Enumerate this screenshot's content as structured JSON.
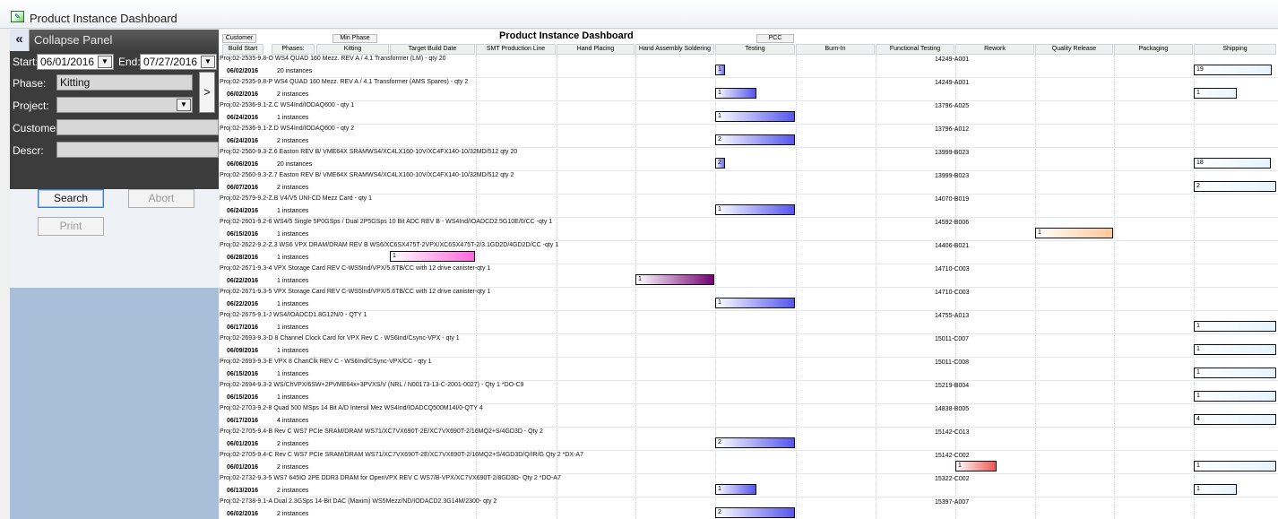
{
  "window": {
    "title": "Product Instance Dashboard"
  },
  "panel": {
    "collapse_label": "Collapse Panel",
    "start_label": "Start:",
    "start_value": "06/01/2016",
    "end_label": "End:",
    "end_value": "07/27/2016",
    "phase_label": "Phase:",
    "phase_value": "Kitting",
    "project_label": "Project:",
    "project_value": "",
    "customer_label": "Customer:",
    "customer_value": "",
    "descr_label": "Descr:",
    "descr_value": "",
    "go_label": ">",
    "search_label": "Search",
    "abort_label": "Abort",
    "print_label": "Print"
  },
  "grid": {
    "title": "Product Instance Dashboard",
    "top_buttons": {
      "customer": "Customer",
      "min_phase": "Min Phase",
      "pcc": "PCC"
    },
    "columns": [
      "Build Start",
      "Phases:",
      "Kitting",
      "Target Build Date",
      "SMT Production Line",
      "Hand Placing",
      "Hand Assembly Soldering",
      "Testing",
      "Burn-In",
      "Functional Testing",
      "Rework",
      "Quality Release",
      "Packaging",
      "Shipping"
    ],
    "rows": [
      {
        "desc": "Proj:02-2535-9.8-O WS4 QUAD 160 Mezz. REV A / 4.1 Transformer (LM) - qty 20",
        "date": "06/02/2016",
        "instances": "20 instances",
        "serial": "14249-A001",
        "bars": [
          {
            "phase": "Testing",
            "label": "1",
            "start": 0.0,
            "len": 0.12,
            "c1": "#ffffff",
            "c2": "#6666ee"
          },
          {
            "phase": "Shipping",
            "label": "19",
            "start": 0.0,
            "len": 0.95,
            "c1": "#ffffff",
            "c2": "#e6f4ff"
          }
        ]
      },
      {
        "desc": "Proj:02-2535-9.8-P WS4 QUAD 160 Mezz. REV A / 4.1 Transformer (AMS Spares) - qty 2",
        "date": "06/02/2016",
        "instances": "2 instances",
        "serial": "14249-A001",
        "bars": [
          {
            "phase": "Testing",
            "label": "1",
            "start": 0.0,
            "len": 0.52,
            "c1": "#ffffff",
            "c2": "#5555ee"
          },
          {
            "phase": "Shipping",
            "label": "1",
            "start": 0.0,
            "len": 0.52,
            "c1": "#ffffff",
            "c2": "#e6f4ff"
          }
        ]
      },
      {
        "desc": "Proj:02-2536-9.1-Z.C WS4Ind/IODAQ600 - qty 1",
        "date": "06/24/2016",
        "instances": "1 instances",
        "serial": "13796-A025",
        "bars": [
          {
            "phase": "Testing",
            "label": "1",
            "start": 0.0,
            "len": 1.0,
            "c1": "#ffffff",
            "c2": "#5555ee"
          }
        ]
      },
      {
        "desc": "Proj:02-2536-9.1-Z.D WS4Ind/IODAQ600 - qty 2",
        "date": "06/24/2016",
        "instances": "2 instances",
        "serial": "13796-A012",
        "bars": [
          {
            "phase": "Testing",
            "label": "2",
            "start": 0.0,
            "len": 1.0,
            "c1": "#ffffff",
            "c2": "#5555ee"
          }
        ]
      },
      {
        "desc": "Proj:02-2560-9.3-Z.6 Easton  REV B/ VME64X SRAMWS4/XC4LX160-10V/XC4FX140-10/32MD/512 qty 20",
        "date": "06/06/2016",
        "instances": "20 instances",
        "serial": "13999-B023",
        "bars": [
          {
            "phase": "Testing",
            "label": "2",
            "start": 0.0,
            "len": 0.12,
            "c1": "#ffffff",
            "c2": "#6666ee"
          },
          {
            "phase": "Shipping",
            "label": "18",
            "start": 0.0,
            "len": 0.93,
            "c1": "#ffffff",
            "c2": "#e6f4ff"
          }
        ]
      },
      {
        "desc": "Proj:02-2560-9.3-Z.7 Easton  REV B/ VME64X SRAMWS4/XC4LX160-10V/XC4FX140-10/32MD/512 qty 2",
        "date": "06/07/2016",
        "instances": "2 instances",
        "serial": "13999-B023",
        "bars": [
          {
            "phase": "Shipping",
            "label": "2",
            "start": 0.0,
            "len": 1.0,
            "c1": "#ffffff",
            "c2": "#e6f4ff"
          }
        ]
      },
      {
        "desc": "Proj:02-2579-9.2-Z.B V4/V5 UNI-CD Mezz Card - qty 1",
        "date": "06/24/2016",
        "instances": "1 instances",
        "serial": "14070-B019",
        "bars": [
          {
            "phase": "Testing",
            "label": "1",
            "start": 0.0,
            "len": 1.0,
            "c1": "#ffffff",
            "c2": "#5555ee"
          }
        ]
      },
      {
        "desc": "Proj:02-2601-9.2-6 WS4/5 Single 5P0GSps / Dual 2P5GSps 10 Bit ADC REV B - WS4Ind/IOADCD2.5G10E/0/CC -qty 1",
        "date": "06/15/2016",
        "instances": "1 instances",
        "serial": "14592-B006",
        "bars": [
          {
            "phase": "Quality Release",
            "label": "1",
            "start": 0.0,
            "len": 1.0,
            "c1": "#ffffff",
            "c2": "#ffc89a"
          }
        ]
      },
      {
        "desc": "Proj:02-2622-9.2-Z.3 WS6 VPX DRAM/DRAM REV B WS6/XC6SX475T-2VPX/XC6SX475T-2/3.1GD2D/4GD2D/CC -qty 1",
        "date": "06/28/2016",
        "instances": "1 instances",
        "serial": "14406-B021",
        "bars": [
          {
            "phase": "Target Build Date",
            "label": "1",
            "start": 0.0,
            "len": 1.0,
            "c1": "#ffffff",
            "c2": "#ff66dd"
          }
        ]
      },
      {
        "desc": "Proj:02-2671-9.3-4 VPX Storage Card REV C-WS5Ind/VPX/5.6TB/CC with 12 drive canister-qty 1",
        "date": "06/22/2016",
        "instances": "1 instances",
        "serial": "14710-C003",
        "bars": [
          {
            "phase": "Hand Assembly Soldering",
            "label": "1",
            "start": 0.0,
            "len": 1.0,
            "c1": "#ffffff",
            "c2": "#770077"
          }
        ]
      },
      {
        "desc": "Proj:02-2671-9.3-5 VPX Storage Card REV C-WS5Ind/VPX/5.6TB/CC with 12 drive canister-qty 1",
        "date": "06/22/2016",
        "instances": "1 instances",
        "serial": "14710-C003",
        "bars": [
          {
            "phase": "Testing",
            "label": "1",
            "start": 0.0,
            "len": 1.0,
            "c1": "#ffffff",
            "c2": "#5555ee"
          }
        ]
      },
      {
        "desc": "Proj:02-2675-9.1-J WS4/IOADCD1.8G12N/0 - QTY 1",
        "date": "06/17/2016",
        "instances": "1 instances",
        "serial": "14755-A013",
        "bars": [
          {
            "phase": "Shipping",
            "label": "1",
            "start": 0.0,
            "len": 1.0,
            "c1": "#ffffff",
            "c2": "#e6f4ff"
          }
        ]
      },
      {
        "desc": "Proj:02-2693-9.3-D 8 Channel Clock Card for VPX Rev C - WS6Ind/Csync-VPX - qty 1",
        "date": "06/09/2016",
        "instances": "1 instances",
        "serial": "15011-C007",
        "bars": [
          {
            "phase": "Shipping",
            "label": "1",
            "start": 0.0,
            "len": 1.0,
            "c1": "#ffffff",
            "c2": "#e6f4ff"
          }
        ]
      },
      {
        "desc": "Proj:02-2693-9.3-E VPX 8 ChanClk REV C - WS6Ind/CSync-VPX/CC - qty 1",
        "date": "06/15/2016",
        "instances": "1 instances",
        "serial": "15011-C008",
        "bars": [
          {
            "phase": "Shipping",
            "label": "1",
            "start": 0.0,
            "len": 1.0,
            "c1": "#ffffff",
            "c2": "#e6f4ff"
          }
        ]
      },
      {
        "desc": "Proj:02-2694-9.3-2 WS/ChVPX/6SW+2PVME64x+3PVXS/V (NRL / N00173-13-C-2001-0027) - Qty 1 *DO-C9",
        "date": "06/15/2016",
        "instances": "1 instances",
        "serial": "15219-B004",
        "bars": [
          {
            "phase": "Shipping",
            "label": "1",
            "start": 0.0,
            "len": 1.0,
            "c1": "#ffffff",
            "c2": "#e6f4ff"
          }
        ]
      },
      {
        "desc": "Proj:02-2703-9.2-8 Quad 500 MSps 14 Bit A/D Intersil Mez WS4Ind/IOADCQ500M14I/0-QTY 4",
        "date": "06/17/2016",
        "instances": "4 instances",
        "serial": "14838-B005",
        "bars": [
          {
            "phase": "Shipping",
            "label": "4",
            "start": 0.0,
            "len": 1.0,
            "c1": "#ffffff",
            "c2": "#e6f4ff"
          }
        ]
      },
      {
        "desc": "Proj:02-2705-9.4-B Rev C WS7 PCIe SRAM/DRAM WS71/XC7VX690T-2E/XC7VX690T-2/16MQ2+S/4GD3D -  Qty 2",
        "date": "06/01/2016",
        "instances": "2 instances",
        "serial": "15142-C013",
        "bars": [
          {
            "phase": "Testing",
            "label": "2",
            "start": 0.0,
            "len": 1.0,
            "c1": "#ffffff",
            "c2": "#5555ee"
          }
        ]
      },
      {
        "desc": "Proj:02-2705-9.4-C Rev C WS7 PCIe SRAM/DRAM WS71/XC7VX690T-2E/XC7VX690T-2/16MQ2+S/4GD3D/Q/IR/G Qty 2 *DX-A7",
        "date": "06/01/2016",
        "instances": "2 instances",
        "serial": "15142-C002",
        "bars": [
          {
            "phase": "Rework",
            "label": "1",
            "start": 0.0,
            "len": 0.52,
            "c1": "#ffffff",
            "c2": "#ee5555"
          },
          {
            "phase": "Shipping",
            "label": "1",
            "start": 0.0,
            "len": 1.0,
            "c1": "#ffffff",
            "c2": "#e6f4ff"
          }
        ]
      },
      {
        "desc": "Proj:02-2732-9.3-5 WS7 645IO 2PE DDR3 DRAM for OpenVPX REV C WS7/B-VPX/XC7VX690T-2/8GD3D- Qty 2 *DO-A7",
        "date": "06/13/2016",
        "instances": "2 instances",
        "serial": "15322-C002",
        "bars": [
          {
            "phase": "Testing",
            "label": "1",
            "start": 0.0,
            "len": 0.52,
            "c1": "#ffffff",
            "c2": "#5555ee"
          },
          {
            "phase": "Shipping",
            "label": "1",
            "start": 0.0,
            "len": 0.52,
            "c1": "#ffffff",
            "c2": "#e6f4ff"
          }
        ]
      },
      {
        "desc": "Proj:02-2738-9.1-A Dual 2.3GSps 14-Bit DAC (Maxim) WS5Mezz/ND/IODACD2.3G14M/2300- qty 2",
        "date": "06/02/2016",
        "instances": "2 instances",
        "serial": "15397-A007",
        "bars": [
          {
            "phase": "Testing",
            "label": "2",
            "start": 0.0,
            "len": 1.0,
            "c1": "#ffffff",
            "c2": "#5555ee"
          }
        ]
      }
    ]
  }
}
